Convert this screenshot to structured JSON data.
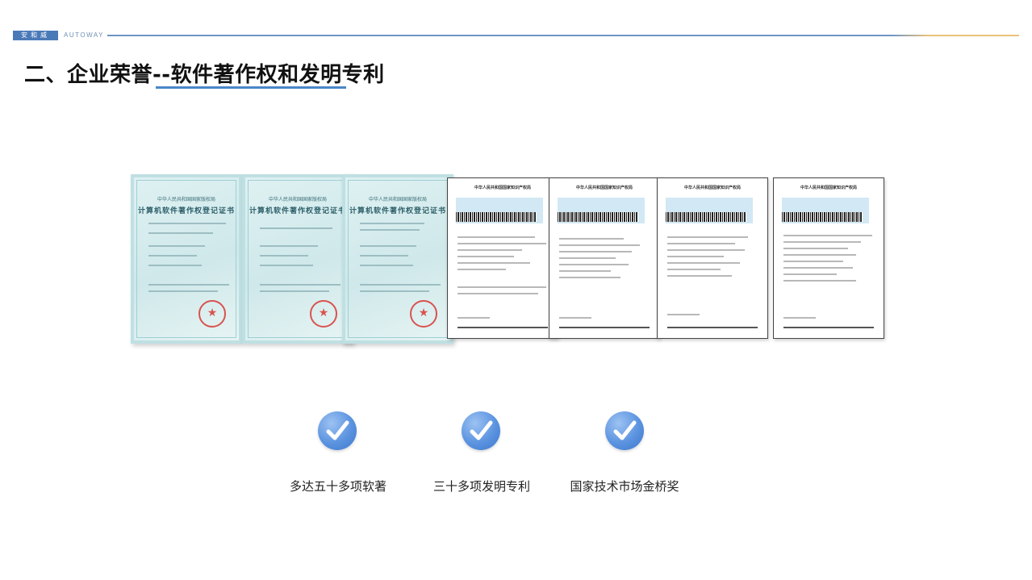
{
  "header": {
    "brand_tag": "安和威",
    "brand_name": "AUTOWAY",
    "accent": "#4a79b8",
    "line_gradient_end": "#e8c27a"
  },
  "title": "二、企业荣誉--软件著作权和发明专利",
  "certificates": {
    "software": [
      {
        "issuer": "中华人民共和国国家版权局",
        "name": "计算机软件著作权登记证书"
      },
      {
        "issuer": "中华人民共和国国家版权局",
        "name": "计算机软件著作权登记证书"
      },
      {
        "issuer": "中华人民共和国国家版权局",
        "name": "计算机软件著作权登记证书"
      }
    ],
    "patents": [
      {
        "issuer": "中华人民共和国国家知识产权局"
      },
      {
        "issuer": "中华人民共和国国家知识产权局"
      },
      {
        "issuer": "中华人民共和国国家知识产权局"
      },
      {
        "issuer": "中华人民共和国国家知识产权局"
      }
    ]
  },
  "features": [
    {
      "icon": "check-icon",
      "label": "多达五十多项软著"
    },
    {
      "icon": "check-icon",
      "label": "三十多项发明专利"
    },
    {
      "icon": "check-icon",
      "label": "国家技术市场金桥奖"
    }
  ],
  "colors": {
    "title_underline": "#4a86c8",
    "icon_blue": "#5b93e0"
  }
}
